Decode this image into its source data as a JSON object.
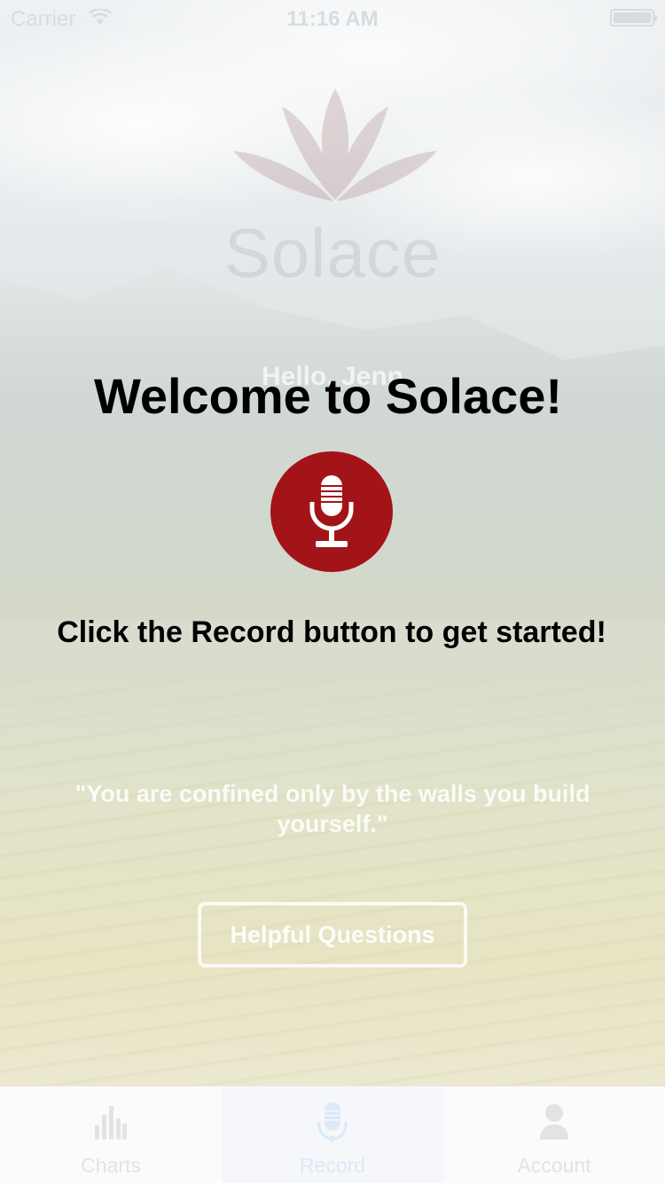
{
  "status_bar": {
    "carrier": "Carrier",
    "time": "11:16 AM"
  },
  "background": {
    "logo_text": "Solace",
    "greeting": "Hello, Jenn",
    "quote": "\"You are confined only by the walls you build yourself.\"",
    "helpful_button_label": "Helpful Questions"
  },
  "overlay": {
    "title": "Welcome to Solace!",
    "instruction": "Click the Record button to get started!",
    "record_icon": "microphone-icon",
    "record_color": "#a31418"
  },
  "tab_bar": {
    "tabs": [
      {
        "label": "Charts",
        "icon": "bar-chart-icon"
      },
      {
        "label": "Record",
        "icon": "microphone-icon",
        "active": true
      },
      {
        "label": "Account",
        "icon": "user-icon"
      }
    ]
  }
}
